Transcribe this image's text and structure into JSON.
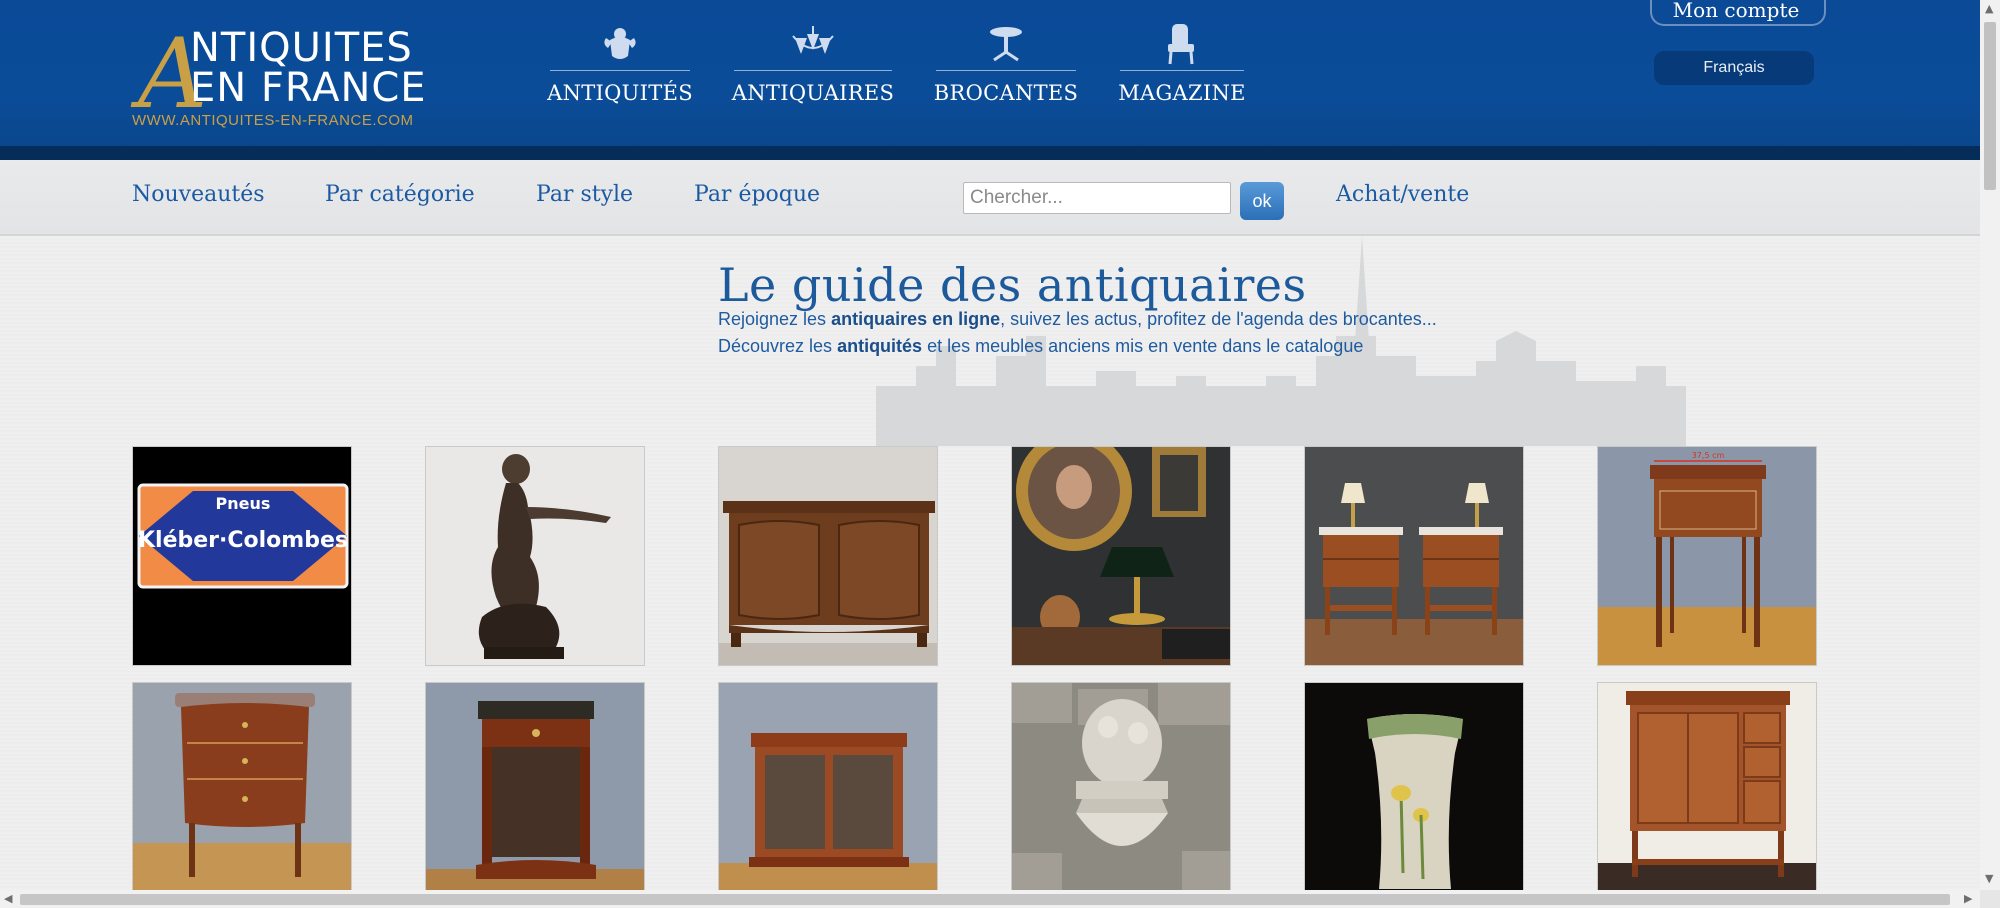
{
  "header": {
    "logo_line1": "NTIQUITES",
    "logo_line2": "EN FRANCE",
    "logo_letter": "A",
    "logo_url": "WWW.ANTIQUITES-EN-FRANCE.COM",
    "nav": [
      {
        "label": "ANTIQUITÉS",
        "icon": "cherub-icon"
      },
      {
        "label": "ANTIQUAIRES",
        "icon": "chandelier-icon"
      },
      {
        "label": "BROCANTES",
        "icon": "gueridon-table-icon"
      },
      {
        "label": "MAGAZINE",
        "icon": "armchair-icon"
      }
    ],
    "account_label": "Mon compte",
    "language": "Français"
  },
  "subnav": {
    "links": [
      "Nouveautés",
      "Par catégorie",
      "Par style",
      "Par époque"
    ],
    "search_placeholder": "Chercher...",
    "ok_label": "ok",
    "achat_label": "Achat/vente"
  },
  "hero": {
    "title": "Le guide des antiquaires",
    "line1_pre": "Rejoignez les ",
    "line1_bold": "antiquaires en ligne",
    "line1_post": ", suivez les actus, profitez de l'agenda des brocantes...",
    "line2_pre": "Découvrez les ",
    "line2_bold": "antiquités",
    "line2_post": " et les meubles anciens mis en vente dans le catalogue"
  },
  "products": [
    {
      "name": "kleber-colombes-enamel-sign",
      "sign_top": "Pneus",
      "sign_main": "Kléber·Colombes"
    },
    {
      "name": "bronze-sculpture"
    },
    {
      "name": "walnut-buffet"
    },
    {
      "name": "portrait-and-bouillotte-lamp"
    },
    {
      "name": "pair-of-bedside-tables"
    },
    {
      "name": "mahogany-side-table",
      "dimension_label": "37,5 cm"
    },
    {
      "name": "marquetry-commode"
    },
    {
      "name": "mahogany-pedestal-table"
    },
    {
      "name": "glass-door-cabinet"
    },
    {
      "name": "stone-wall-fountain"
    },
    {
      "name": "art-nouveau-vase"
    },
    {
      "name": "carved-walnut-cabinet"
    }
  ],
  "colors": {
    "header_blue": "#0a4a97",
    "link_blue": "#1b5aa3",
    "gold": "#c9a046"
  }
}
